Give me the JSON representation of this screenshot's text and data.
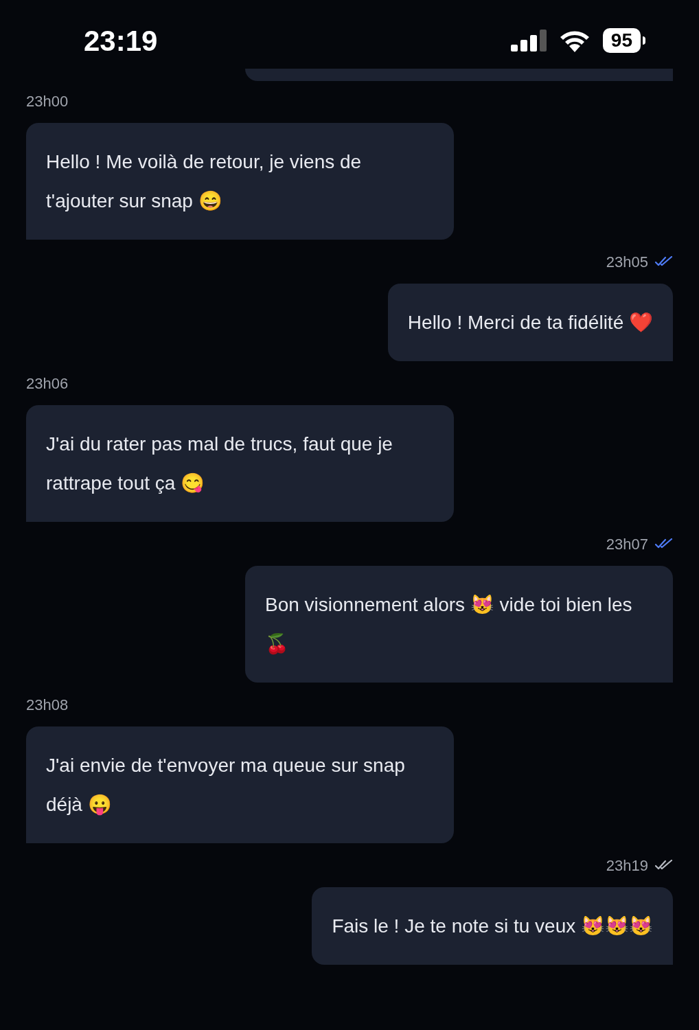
{
  "status_bar": {
    "time": "23:19",
    "battery": "95"
  },
  "clipped_bubble": {
    "outgoing": true
  },
  "messages": [
    {
      "outgoing": false,
      "time": "23h00",
      "text": "Hello ! Me voilà de retour, je viens de t'ajouter sur snap 😄"
    },
    {
      "outgoing": true,
      "time": "23h05",
      "read": true,
      "text": "Hello ! Merci de ta fidélité ❤️"
    },
    {
      "outgoing": false,
      "time": "23h06",
      "text": "J'ai du rater pas mal de trucs, faut que je rattrape tout ça 😋"
    },
    {
      "outgoing": true,
      "time": "23h07",
      "read": true,
      "text": "Bon visionnement alors 😻 vide toi bien les 🍒"
    },
    {
      "outgoing": false,
      "time": "23h08",
      "text": "J'ai envie de t'envoyer ma queue sur snap déjà 😛"
    },
    {
      "outgoing": true,
      "time": "23h19",
      "read": false,
      "text": "Fais le ! Je te note si tu veux 😻😻😻"
    }
  ]
}
